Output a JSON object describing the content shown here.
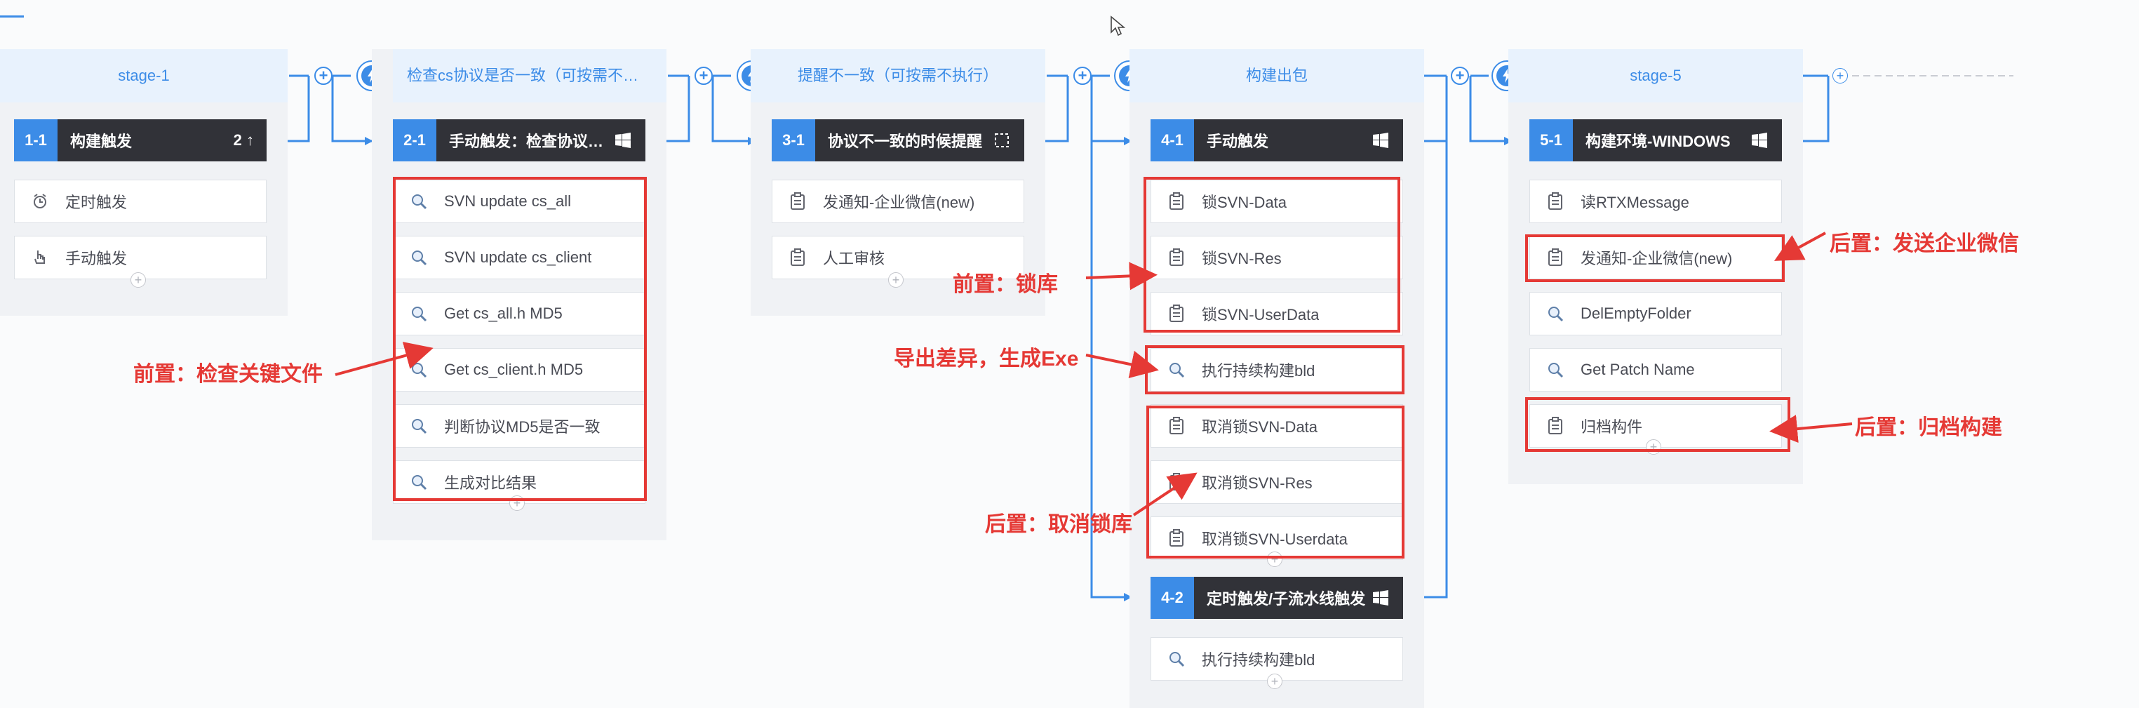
{
  "stages": [
    {
      "title": "stage-1"
    },
    {
      "title": "检查cs协议是否一致（可按需不执行）"
    },
    {
      "title": "提醒不一致（可按需不执行）"
    },
    {
      "title": "构建出包"
    },
    {
      "title": "stage-5"
    }
  ],
  "jobs": {
    "j11": {
      "num": "1-1",
      "title": "构建触发",
      "badge": "2 ↑"
    },
    "j21": {
      "num": "2-1",
      "title": "手动触发：检查协议一致性"
    },
    "j31": {
      "num": "3-1",
      "title": "协议不一致的时候提醒"
    },
    "j41": {
      "num": "4-1",
      "title": "手动触发"
    },
    "j42": {
      "num": "4-2",
      "title": "定时触发/子流水线触发"
    },
    "j51": {
      "num": "5-1",
      "title": "构建环境-WINDOWS"
    }
  },
  "tasks": {
    "j11": [
      "定时触发",
      "手动触发"
    ],
    "j21": [
      "SVN update cs_all",
      "SVN update cs_client",
      "Get cs_all.h MD5",
      "Get cs_client.h MD5",
      "判断协议MD5是否一致",
      "生成对比结果"
    ],
    "j31": [
      "发通知-企业微信(new)",
      "人工审核"
    ],
    "j41": [
      "锁SVN-Data",
      "锁SVN-Res",
      "锁SVN-UserData",
      "执行持续构建bld",
      "取消锁SVN-Data",
      "取消锁SVN-Res",
      "取消锁SVN-Userdata"
    ],
    "j42": [
      "执行持续构建bld"
    ],
    "j51": [
      "读RTXMessage",
      "发通知-企业微信(new)",
      "DelEmptyFolder",
      "Get Patch Name",
      "归档构件"
    ]
  },
  "annotations": {
    "a1": "前置：检查关键文件",
    "a2": "前置：锁库",
    "a3": "导出差异，生成Exe",
    "a4": "后置：取消锁库",
    "a5": "后置：发送企业微信",
    "a6": "后置：归档构建"
  },
  "icons": {
    "trigger_timer": "alarm-clock-icon",
    "trigger_manual": "hand-pointer-icon",
    "search_task": "magnifier-icon",
    "clipboard_task": "clipboard-icon",
    "windows": "windows-logo-icon",
    "stage_trigger": "lightning-icon"
  },
  "colors": {
    "accent": "#3c8ce7",
    "job_header": "#313238",
    "annotation": "#e53935"
  }
}
